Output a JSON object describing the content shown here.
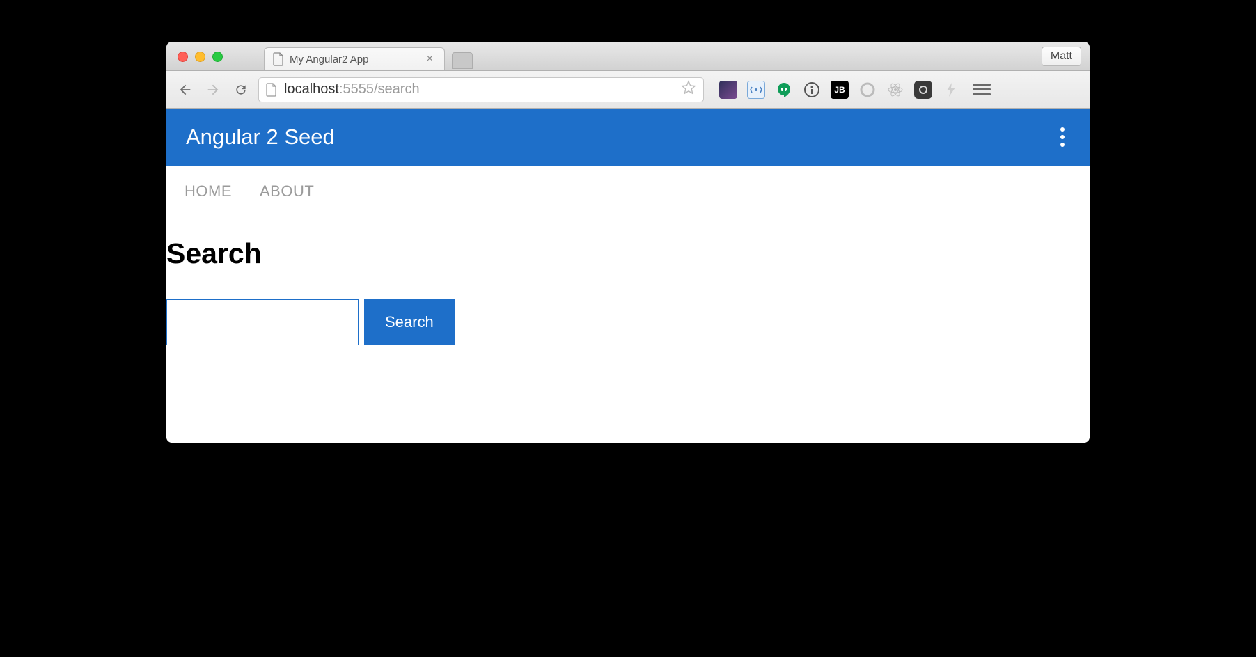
{
  "browser": {
    "tab_title": "My Angular2 App",
    "user_label": "Matt",
    "url_host": "localhost",
    "url_port_path": ":5555/search"
  },
  "app": {
    "header_title": "Angular 2 Seed"
  },
  "nav": {
    "items": [
      "HOME",
      "ABOUT"
    ]
  },
  "page": {
    "heading": "Search",
    "search_value": "",
    "search_button_label": "Search"
  }
}
